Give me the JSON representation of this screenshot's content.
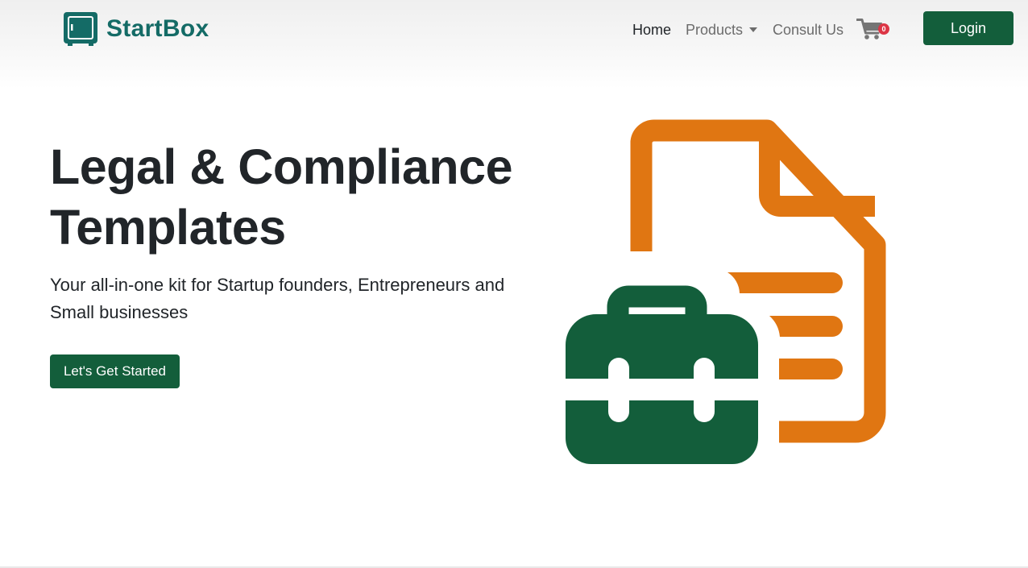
{
  "brand": {
    "name": "StartBox",
    "icon": "safe-box-logo-icon"
  },
  "nav": {
    "home_label": "Home",
    "products_label": "Products",
    "consult_label": "Consult Us",
    "cart_count": "0",
    "login_label": "Login"
  },
  "hero": {
    "title_line1": "Legal & Compliance",
    "title_line2": "Templates",
    "subtitle": "Your all-in-one kit for Startup founders, Entrepreneurs and Small businesses",
    "cta_label": "Let's Get Started",
    "illustration_icons": [
      "document-icon",
      "briefcase-icon"
    ]
  },
  "colors": {
    "primary_green": "#135e3b",
    "brand_teal": "#146b66",
    "accent_orange": "#e07612",
    "badge_red": "#dc3545",
    "text_dark": "#212529",
    "nav_muted": "#6c6c6c"
  }
}
